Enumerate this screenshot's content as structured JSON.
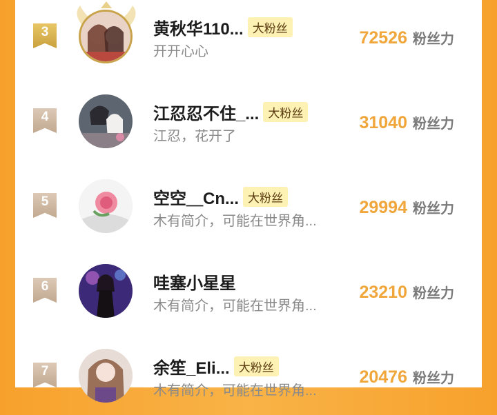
{
  "colors": {
    "accent": "#f0a63a",
    "badge_bg": "#fdf1b4",
    "gold": "#c9a34a",
    "page_bg": "#f7a12c"
  },
  "rows": [
    {
      "rank": "3",
      "name": "黄秋华110...",
      "badge": "大粉丝",
      "desc": "开开心心",
      "score": "72526",
      "unit": "粉丝力",
      "avatar_icon": "couple-avatar"
    },
    {
      "rank": "4",
      "name": "江忍忍不住_...",
      "badge": "大粉丝",
      "desc": "江忍，花开了",
      "score": "31040",
      "unit": "粉丝力",
      "avatar_icon": "anime-couple-avatar"
    },
    {
      "rank": "5",
      "name": "空空＿Cn...",
      "badge": "大粉丝",
      "desc": "木有简介，可能在世界角...",
      "score": "29994",
      "unit": "粉丝力",
      "avatar_icon": "rose-avatar"
    },
    {
      "rank": "6",
      "name": "哇塞小星星",
      "badge": "",
      "desc": "木有简介，可能在世界角...",
      "score": "23210",
      "unit": "粉丝力",
      "avatar_icon": "girl-avatar"
    },
    {
      "rank": "7",
      "name": "余笙_Eli...",
      "badge": "大粉丝",
      "desc": "木有简介，可能在世界角...",
      "score": "20476",
      "unit": "粉丝力",
      "avatar_icon": "anime-girl-avatar"
    }
  ]
}
